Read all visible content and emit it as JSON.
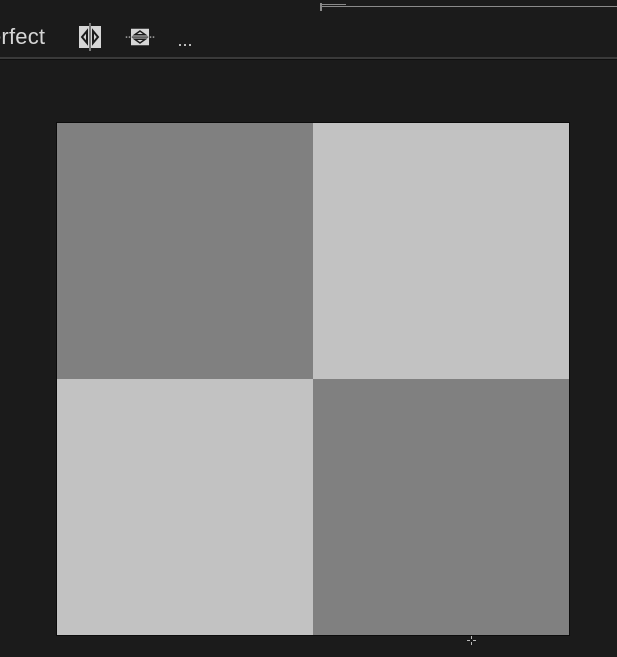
{
  "toolbar": {
    "pixel_perfect_label": "erfect",
    "symmetry_horizontal_icon": "symmetry-horizontal-icon",
    "symmetry_vertical_icon": "symmetry-vertical-icon",
    "more_label": "..."
  },
  "canvas": {
    "checker_light_color": "#c2c2c2",
    "checker_dark_color": "#808080",
    "background_color": "#1b1b1b"
  },
  "cursor": {
    "icon": "crosshair-icon"
  }
}
